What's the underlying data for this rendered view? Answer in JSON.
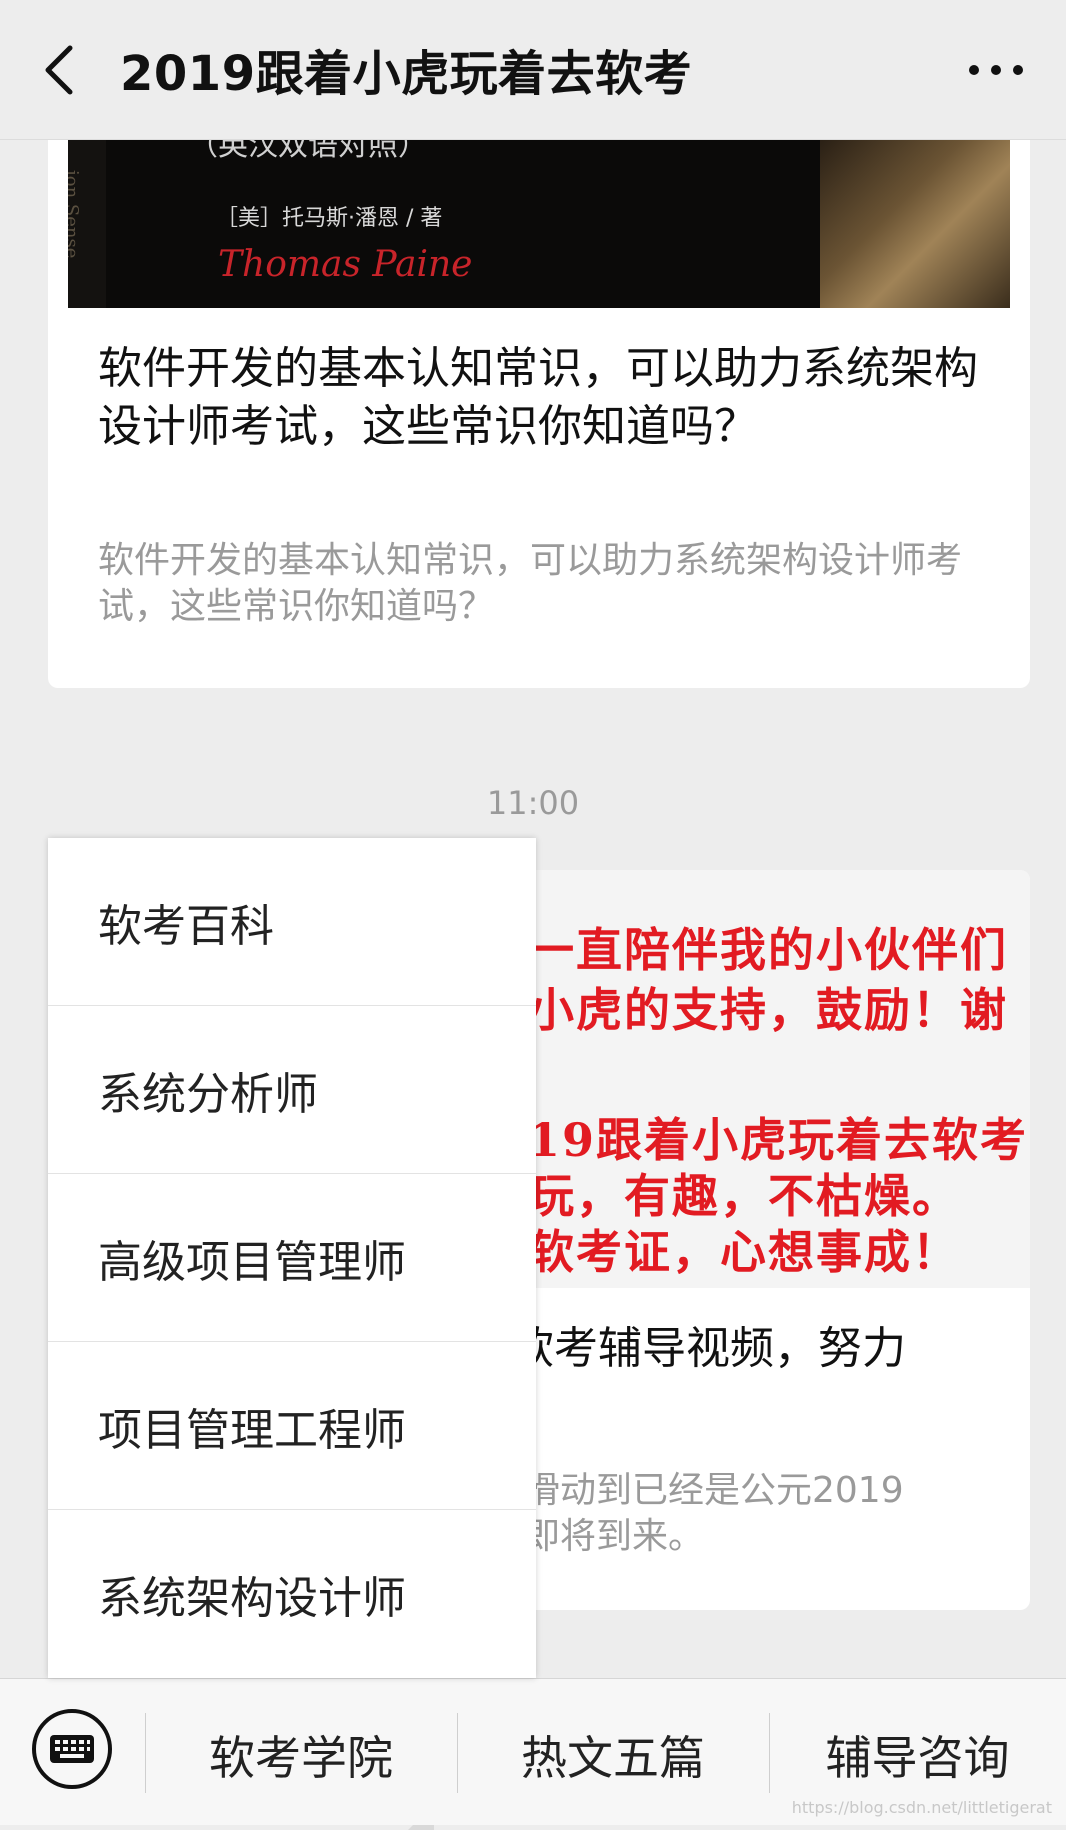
{
  "header": {
    "title": "2019跟着小虎玩着去软考",
    "back_icon": "chevron-left-icon",
    "more_icon": "more-horizontal-icon"
  },
  "article1": {
    "cover": {
      "spine_text": "ion Sense",
      "top_line": "（英汉双语对照）",
      "author": "［美］托马斯·潘恩 / 著",
      "signature": "Thomas Paine"
    },
    "title": "软件开发的基本认知常识，可以助力系统架构设计师考试，这些常识你知道吗？",
    "digest": "软件开发的基本认知常识，可以助力系统架构设计师考试，这些常识你知道吗？"
  },
  "timestamp": "11:00",
  "article2": {
    "cover_lines": [
      "一直陪伴我的小伙伴们",
      "小虎的支持，鼓励！谢",
      "19跟着小虎玩着去软考",
      "玩，有趣，不枯燥。",
      "软考证，心想事成！"
    ],
    "title_visible": "软考辅导视频，努力",
    "digest_visible_1": "滑动到已经是公元2019",
    "digest_visible_2": "即将到来。"
  },
  "popup_menu": {
    "items": [
      "软考百科",
      "系统分析师",
      "高级项目管理师",
      "项目管理工程师",
      "系统架构设计师"
    ]
  },
  "bottom_menu": {
    "keyboard_icon": "keyboard-icon",
    "items": [
      "软考学院",
      "热文五篇",
      "辅导咨询"
    ]
  },
  "watermark": "https://blog.csdn.net/littletigerat"
}
